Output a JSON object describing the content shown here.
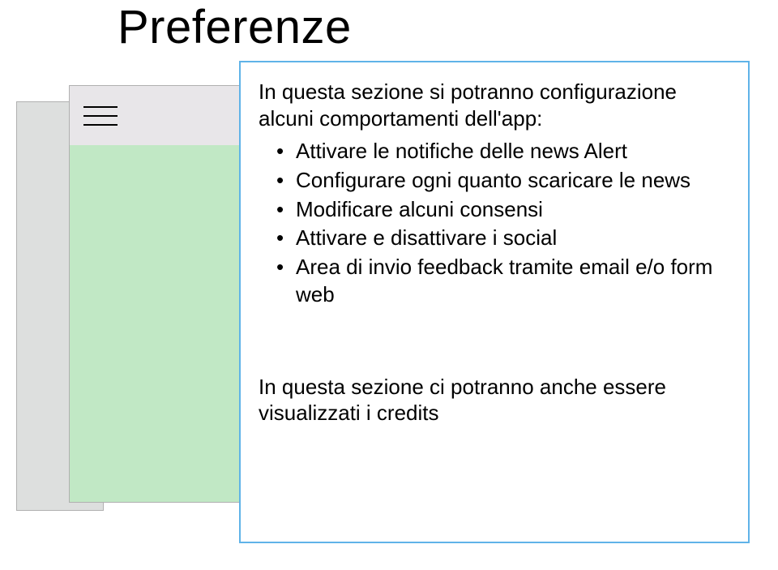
{
  "title": "Preferenze",
  "intro": "In questa sezione si potranno configurazione alcuni comportamenti dell'app:",
  "bullets": {
    "item0": "Attivare le notifiche delle news Alert",
    "item1": "Configurare ogni quanto scaricare le news",
    "item2": "Modificare alcuni consensi",
    "item3": "Attivare e disattivare i social",
    "item4": "Area di invio feedback tramite email e/o form web"
  },
  "footer": "In questa sezione ci potranno anche essere visualizzati i credits",
  "icons": {
    "hamburger": "menu-icon"
  },
  "colors": {
    "mockup_header": "#e8e6e9",
    "mockup_body": "#c1e8c5",
    "mockup_back": "#dddfde",
    "box_border": "#5fb3e8"
  }
}
